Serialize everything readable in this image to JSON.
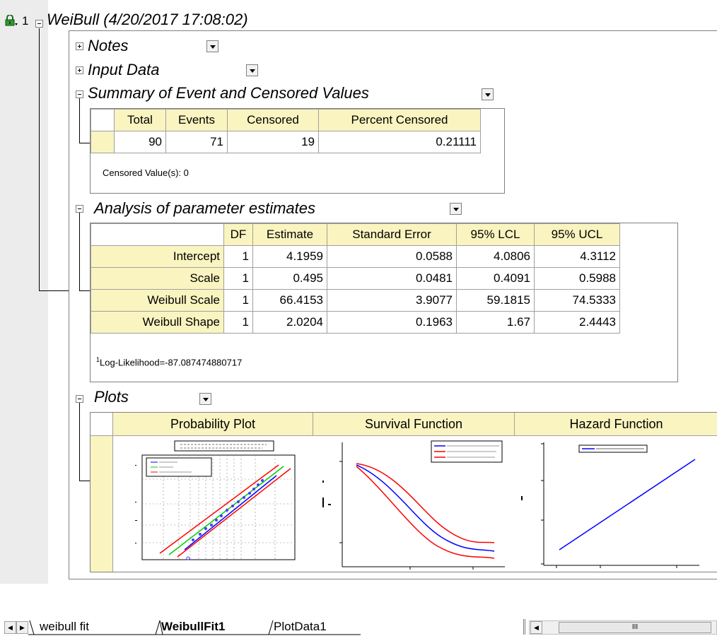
{
  "row_number": "1",
  "report_title": "WeiBull (4/20/2017 17:08:02)",
  "sections": {
    "notes": "Notes",
    "input_data": "Input Data",
    "summary": "Summary of Event and Censored Values",
    "analysis": "Analysis of parameter estimates",
    "plots": "Plots"
  },
  "summary_table": {
    "headers": [
      "Total",
      "Events",
      "Censored",
      "Percent Censored"
    ],
    "values": [
      "90",
      "71",
      "19",
      "0.21111"
    ],
    "note": "Censored Value(s): 0"
  },
  "param_table": {
    "headers": [
      "DF",
      "Estimate",
      "Standard Error",
      "95% LCL",
      "95% UCL"
    ],
    "rows": [
      {
        "label": "Intercept",
        "cells": [
          "1",
          "4.1959",
          "0.0588",
          "4.0806",
          "4.3112"
        ]
      },
      {
        "label": "Scale",
        "cells": [
          "1",
          "0.495",
          "0.0481",
          "0.4091",
          "0.5988"
        ]
      },
      {
        "label": "Weibull Scale",
        "cells": [
          "1",
          "66.4153",
          "3.9077",
          "59.1815",
          "74.5333"
        ]
      },
      {
        "label": "Weibull Shape",
        "cells": [
          "1",
          "2.0204",
          "0.1963",
          "1.67",
          "2.4443"
        ]
      }
    ],
    "footnote_mark": "1",
    "footnote": "Log-Likelihood=-87.087474880717"
  },
  "plots_table": {
    "headers": [
      "Probability Plot",
      "Survival Function",
      "Hazard Function"
    ]
  },
  "tabs": [
    "weibull fit",
    "WeibullFit1",
    "PlotData1"
  ],
  "active_tab": "WeibullFit1",
  "scroll_grip": "III",
  "colors": {
    "header_bg": "#faf4c0",
    "fit_line": "#0000ff",
    "ci_line": "#ff0000",
    "green_line": "#00cc00"
  }
}
